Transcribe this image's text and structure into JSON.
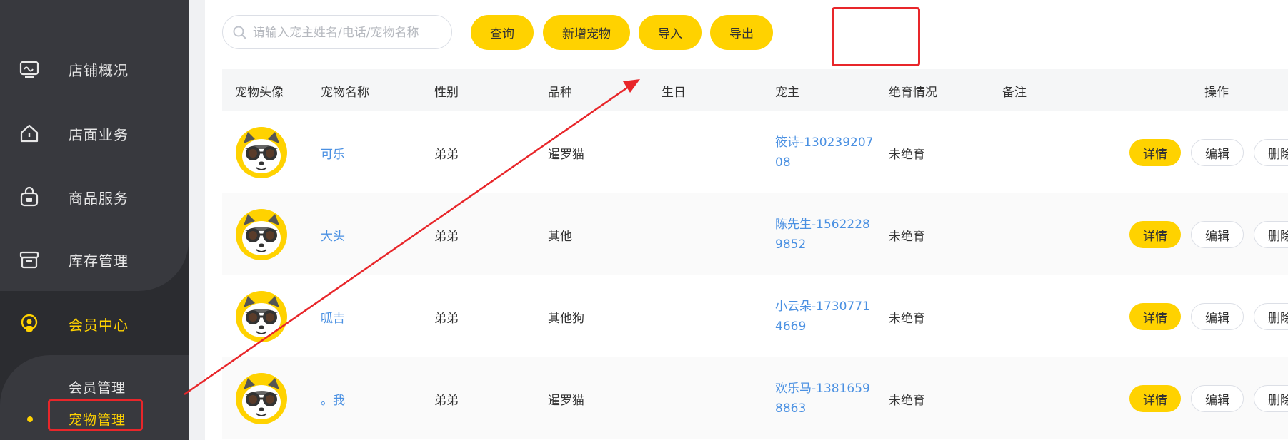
{
  "sidebar": {
    "items": [
      {
        "label": "店铺概况",
        "icon": "monitor-icon"
      },
      {
        "label": "店面业务",
        "icon": "house-icon"
      },
      {
        "label": "商品服务",
        "icon": "bag-icon"
      },
      {
        "label": "库存管理",
        "icon": "archive-box-icon"
      },
      {
        "label": "会员中心",
        "icon": "member-icon"
      }
    ],
    "sub_items": [
      {
        "label": "会员管理"
      },
      {
        "label": "宠物管理"
      }
    ]
  },
  "toolbar": {
    "search_placeholder": "请输入宠主姓名/电话/宠物名称",
    "search_value": "",
    "query_label": "查询",
    "add_label": "新增宠物",
    "import_label": "导入",
    "export_label": "导出"
  },
  "table": {
    "headers": [
      "宠物头像",
      "宠物名称",
      "性别",
      "品种",
      "生日",
      "宠主",
      "绝育情况",
      "备注",
      "操作"
    ],
    "rows": [
      {
        "name": "可乐",
        "gender": "弟弟",
        "breed": "暹罗猫",
        "birthday": "",
        "owner": "筱诗-13023920708",
        "sterilized": "未绝育",
        "remark": ""
      },
      {
        "name": "大头",
        "gender": "弟弟",
        "breed": "其他",
        "birthday": "",
        "owner": "陈先生-15622289852",
        "sterilized": "未绝育",
        "remark": ""
      },
      {
        "name": "呱吉",
        "gender": "弟弟",
        "breed": "其他狗",
        "birthday": "",
        "owner": "小云朵-17307714669",
        "sterilized": "未绝育",
        "remark": ""
      },
      {
        "name": "。我",
        "gender": "弟弟",
        "breed": "暹罗猫",
        "birthday": "",
        "owner": "欢乐马-13816598863",
        "sterilized": "未绝育",
        "remark": ""
      }
    ],
    "actions": {
      "detail": "详情",
      "edit": "编辑",
      "delete": "删除"
    }
  },
  "colors": {
    "accent": "#ffd200",
    "sidebar_bg": "#2b2c30",
    "link": "#4a90e2",
    "annotation": "#e8262a"
  }
}
